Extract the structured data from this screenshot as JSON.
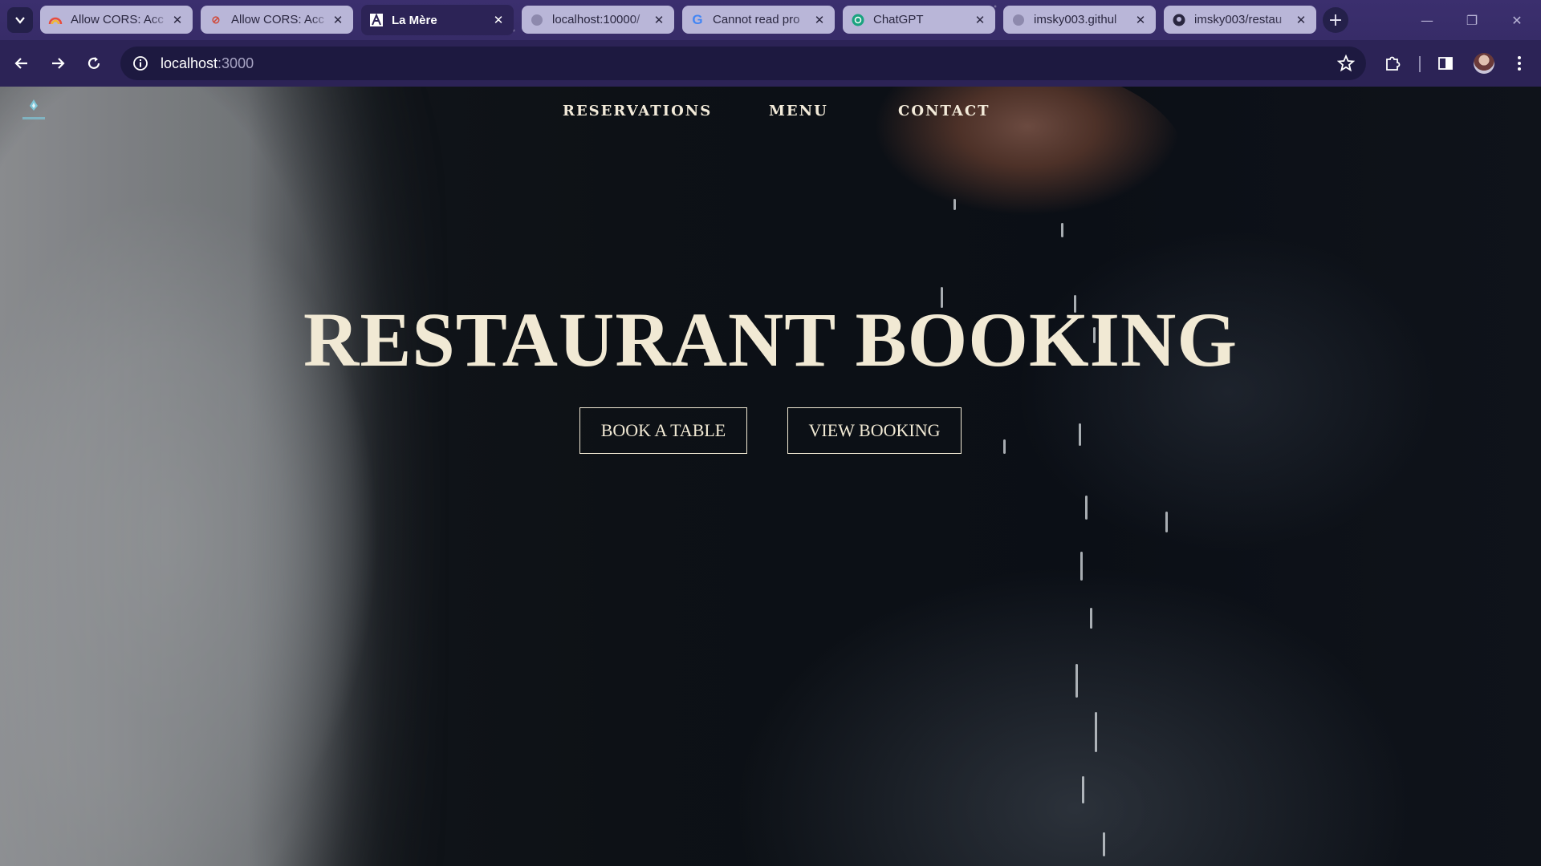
{
  "browser": {
    "tabs": [
      {
        "title": "Allow CORS: Acc",
        "favicon": "rainbow-icon",
        "active": false
      },
      {
        "title": "Allow CORS: Acc",
        "favicon": "cors-icon",
        "active": false
      },
      {
        "title": "La Mère",
        "favicon": "la-mere-logo-icon",
        "active": true
      },
      {
        "title": "localhost:10000/",
        "favicon": "globe-icon",
        "active": false
      },
      {
        "title": "Cannot read pro",
        "favicon": "google-icon",
        "active": false
      },
      {
        "title": "ChatGPT",
        "favicon": "chatgpt-icon",
        "active": false
      },
      {
        "title": "imsky003.githul",
        "favicon": "globe-icon",
        "active": false
      },
      {
        "title": "imsky003/restau",
        "favicon": "github-icon",
        "active": false
      }
    ],
    "address": {
      "host": "localhost",
      "port": ":3000"
    },
    "colors": {
      "frame": "#3a2f6b",
      "toolbar": "#2c2356",
      "omnibox": "#1d1940"
    }
  },
  "page": {
    "nav": {
      "reservations": "RESERVATIONS",
      "menu": "MENU",
      "contact": "CONTACT"
    },
    "hero": {
      "title": "RESTAURANT BOOKING",
      "book_button": "BOOK A TABLE",
      "view_button": "VIEW BOOKING"
    },
    "colors": {
      "accent_text": "#f1e9d4",
      "background": "#0b0f16"
    }
  }
}
